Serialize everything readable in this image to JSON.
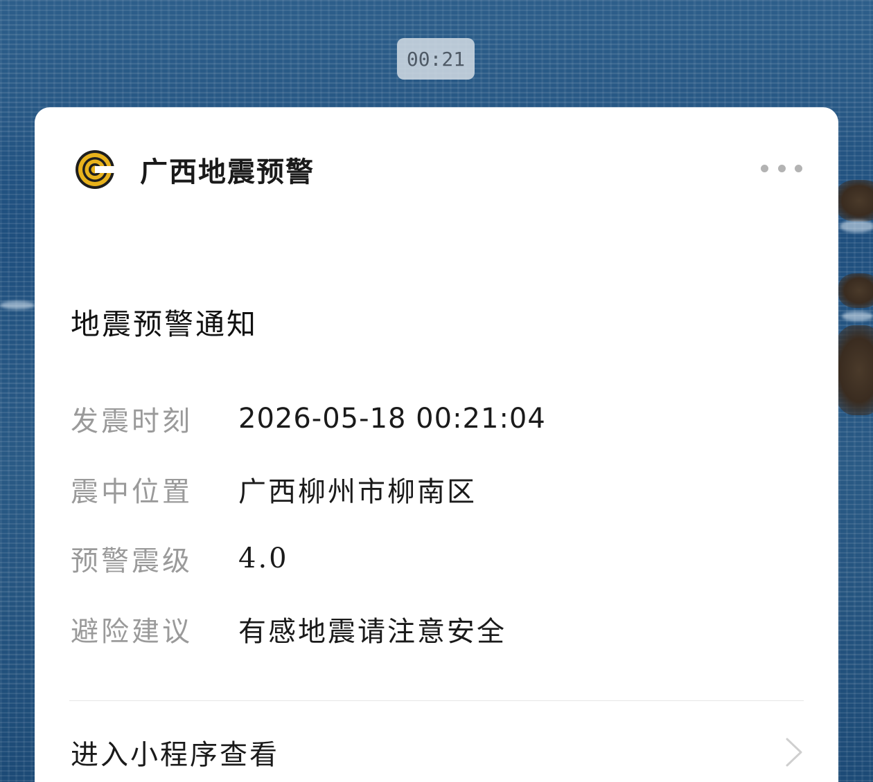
{
  "chat": {
    "timestamp": "00:21"
  },
  "card": {
    "account_name": "广西地震预警",
    "logo_icon": "earthquake-warning-logo-icon",
    "more_icon": "more-dots-icon",
    "notice_title": "地震预警通知",
    "rows": [
      {
        "label": "发震时刻",
        "value": "2026-05-18 00:21:04"
      },
      {
        "label": "震中位置",
        "value": "广西柳州市柳南区"
      },
      {
        "label": "预警震级",
        "value": "4.0"
      },
      {
        "label": "避险建议",
        "value": "有感地震请注意安全"
      }
    ],
    "footer_link": "进入小程序查看",
    "footer_icon": "chevron-right-icon"
  },
  "colors": {
    "logo_yellow": "#e8b21c",
    "logo_dark": "#1e1e1e",
    "label_gray": "#9a9a9a",
    "card_bg": "#ffffff"
  }
}
